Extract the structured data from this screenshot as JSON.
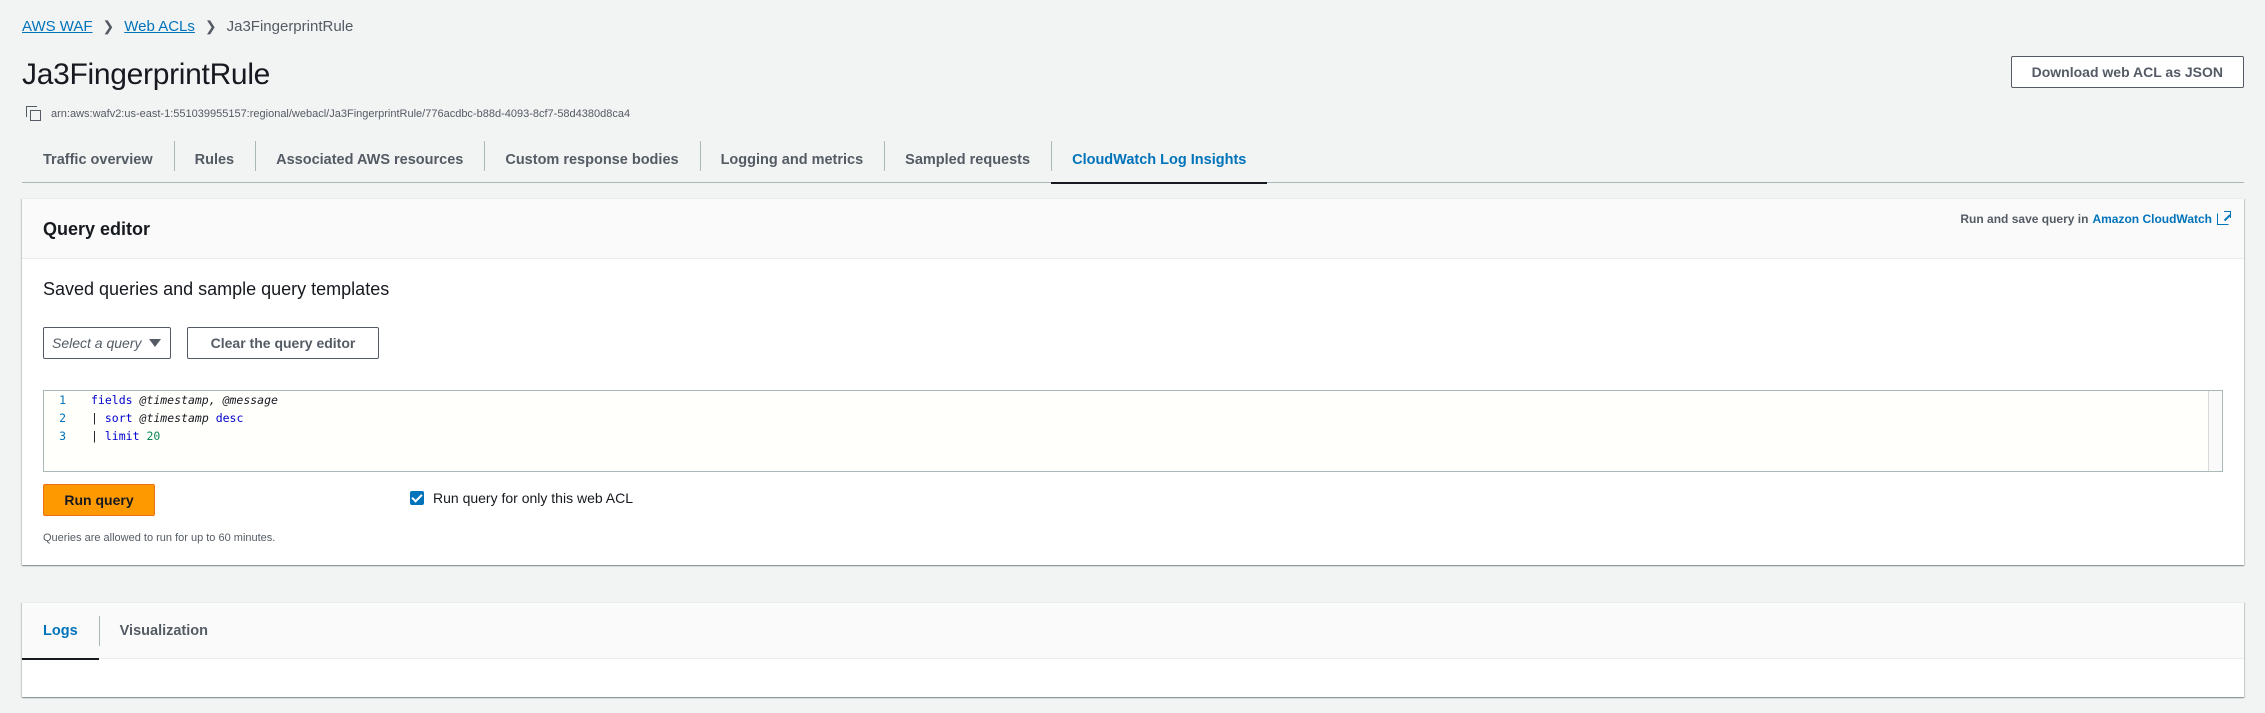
{
  "breadcrumb": {
    "items": [
      "AWS WAF",
      "Web ACLs"
    ],
    "current": "Ja3FingerprintRule",
    "separator": ">"
  },
  "page": {
    "title": "Ja3FingerprintRule",
    "arn": "arn:aws:wafv2:us-east-1:551039955157:regional/webacl/Ja3FingerprintRule/776acdbc-b88d-4093-8cf7-58d4380d8ca4",
    "download_label": "Download web ACL as JSON"
  },
  "tabs": [
    {
      "label": "Traffic overview",
      "active": false
    },
    {
      "label": "Rules",
      "active": false
    },
    {
      "label": "Associated AWS resources",
      "active": false
    },
    {
      "label": "Custom response bodies",
      "active": false
    },
    {
      "label": "Logging and metrics",
      "active": false
    },
    {
      "label": "Sampled requests",
      "active": false
    },
    {
      "label": "CloudWatch Log Insights",
      "active": true
    }
  ],
  "query_editor": {
    "title": "Query editor",
    "run_save_prefix": "Run and save query in",
    "run_save_link": "Amazon CloudWatch",
    "section_title": "Saved queries and sample query templates",
    "select_placeholder": "Select a query",
    "clear_label": "Clear the query editor",
    "code": {
      "line_numbers": [
        "1",
        "2",
        "3"
      ],
      "line1": {
        "kw": "fields",
        "rest": "@timestamp, @message"
      },
      "line2": {
        "pipe": "|",
        "kw": "sort",
        "field": "@timestamp",
        "order": "desc"
      },
      "line3": {
        "pipe": "|",
        "kw": "limit",
        "num": "20"
      }
    },
    "run_label": "Run query",
    "checkbox_label": "Run query for only this web ACL",
    "checkbox_checked": true,
    "hint": "Queries are allowed to run for up to 60 minutes."
  },
  "results": {
    "tabs": [
      {
        "label": "Logs",
        "active": true
      },
      {
        "label": "Visualization",
        "active": false
      }
    ]
  },
  "colors": {
    "link": "#0073bb",
    "primary_button": "#ff9900",
    "background": "#f2f3f3"
  }
}
